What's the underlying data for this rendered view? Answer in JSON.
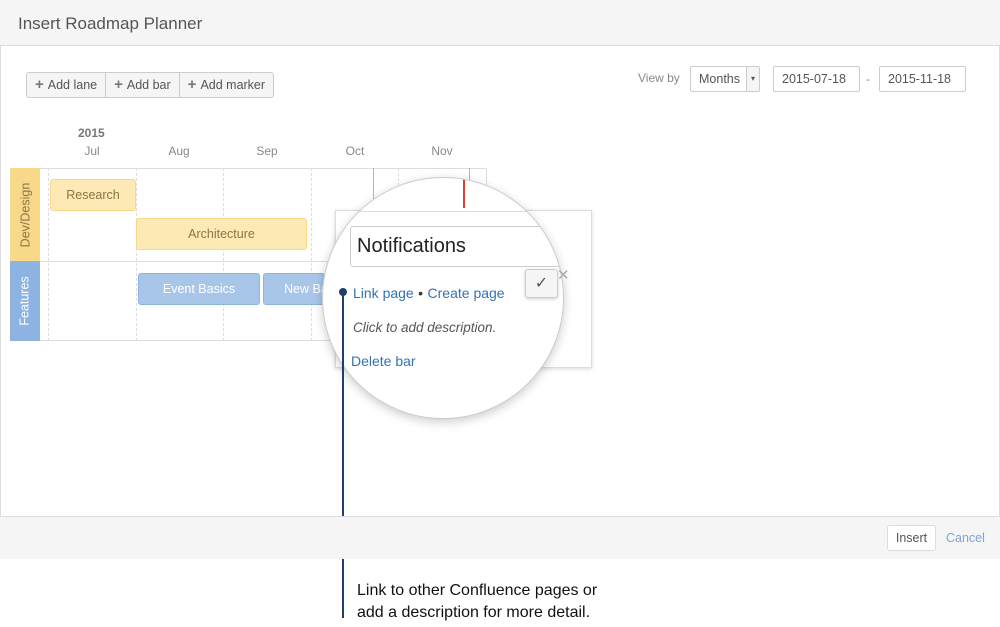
{
  "title": "Insert Roadmap Planner",
  "toolbar": {
    "add_lane": "Add lane",
    "add_bar": "Add bar",
    "add_marker": "Add marker"
  },
  "view": {
    "label": "View by",
    "selected": "Months",
    "start": "2015-07-18",
    "separator": "-",
    "end": "2015-11-18"
  },
  "timeline": {
    "year": "2015",
    "months": [
      "Jul",
      "Aug",
      "Sep",
      "Oct",
      "Nov"
    ]
  },
  "lanes": [
    {
      "name": "Dev/Design",
      "color": "#f8d98a",
      "bars": [
        "Research",
        "Architecture"
      ]
    },
    {
      "name": "Features",
      "color": "#8db3e2",
      "bars": [
        "Event Basics",
        "New Ba"
      ]
    }
  ],
  "popup": {
    "title_value": "Notifications",
    "link_page": "Link page",
    "bullet": "•",
    "create_page": "Create page",
    "description": "Click to add description.",
    "delete": "Delete bar",
    "confirm_icon": "check-icon",
    "cancel_icon": "close-icon"
  },
  "footer": {
    "insert": "Insert",
    "cancel": "Cancel"
  },
  "annotation": {
    "line1": "Link to other Confluence pages or",
    "line2": "add a description for more detail."
  },
  "colors": {
    "marker": "#d04437",
    "link": "#3572b0",
    "callout": "#1f3f66"
  }
}
